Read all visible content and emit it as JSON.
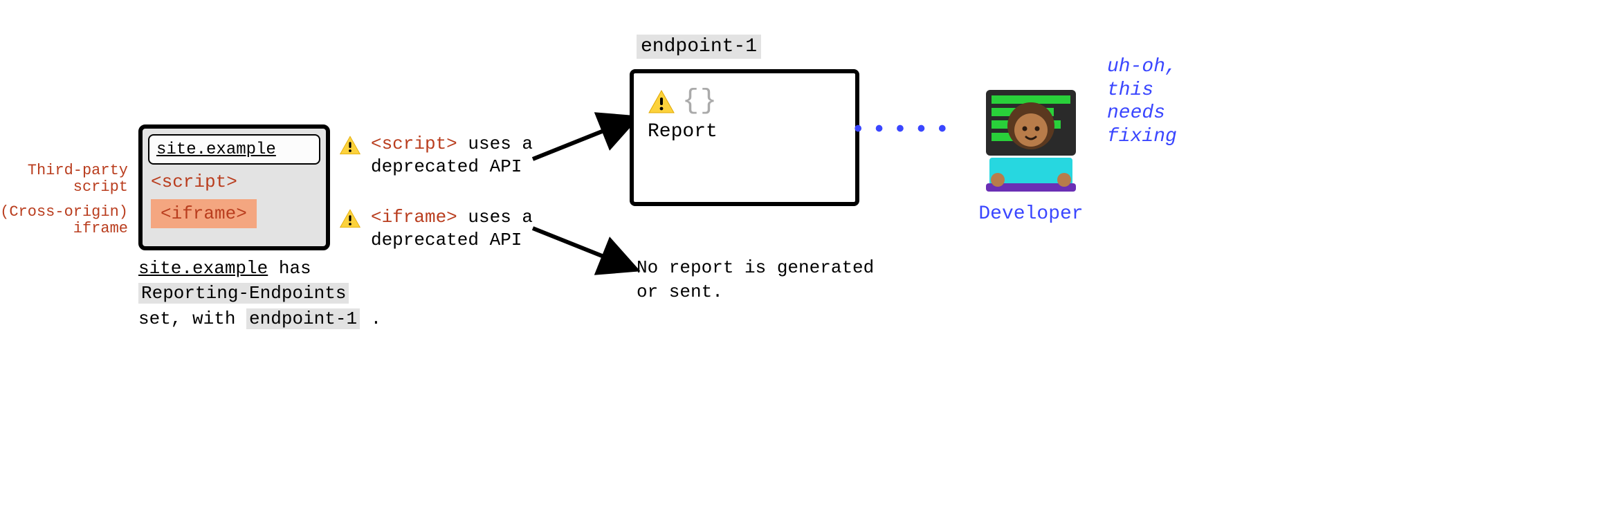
{
  "source": {
    "domain": "site.example",
    "script_tag": "<script>",
    "iframe_tag": "<iframe>",
    "side_note_script": "Third-party\nscript",
    "side_note_iframe": "(Cross-origin)\niframe",
    "caption_domain": "site.example",
    "caption_mid": " has ",
    "caption_header": "Reporting-Endpoints",
    "caption_tail": "set, with ",
    "caption_endpoint": "endpoint-1",
    "caption_end": " ."
  },
  "warnings": {
    "script": {
      "tag": "<script>",
      "text": " uses a deprecated API"
    },
    "iframe": {
      "tag": "<iframe>",
      "text": " uses a deprecated API"
    }
  },
  "endpoint": {
    "name": "endpoint-1",
    "braces": "{}",
    "report_label": "Report"
  },
  "no_report": "No report is generated or sent.",
  "developer": {
    "label": "Developer",
    "thought": "uh-oh,\nthis\nneeds\nfixing",
    "dots": "•••••"
  },
  "icons": {
    "warning": "warning-triangle-icon"
  }
}
